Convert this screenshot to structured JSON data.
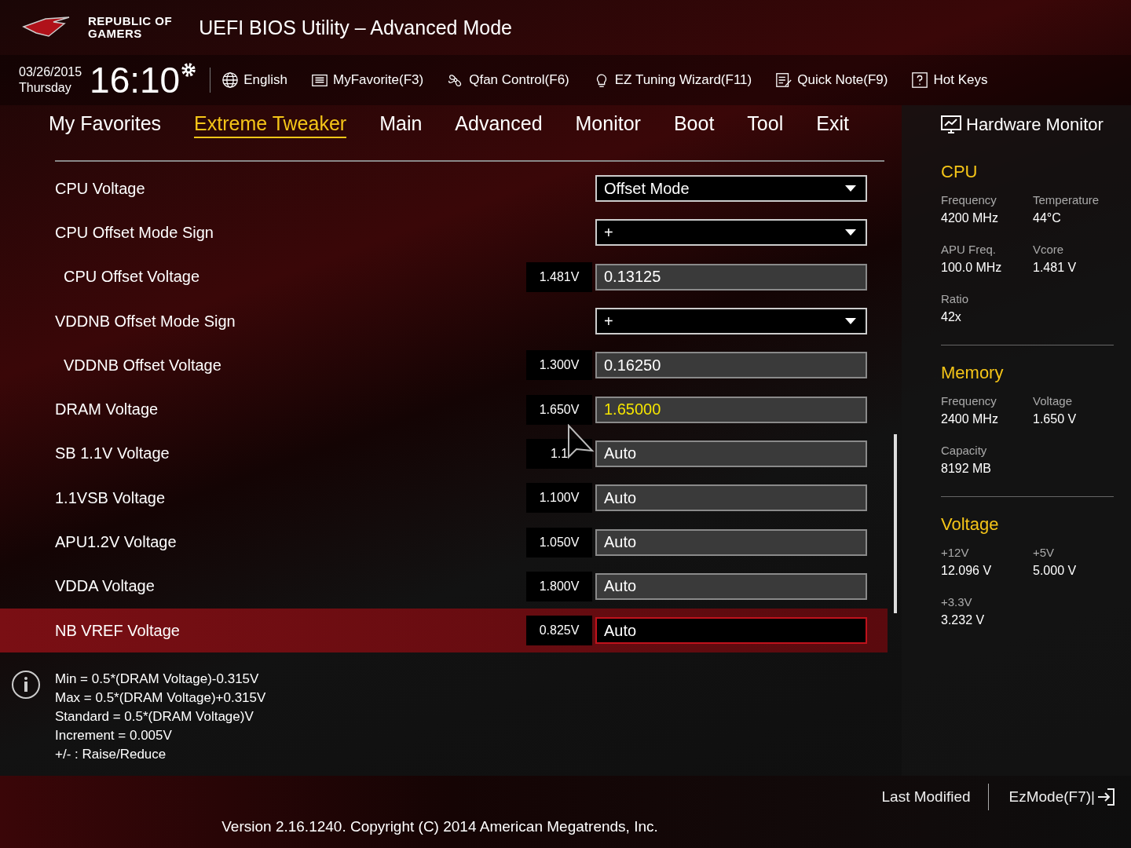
{
  "header": {
    "brand_line_1": "REPUBLIC OF",
    "brand_line_2": "GAMERS",
    "title": "UEFI BIOS Utility – Advanced Mode",
    "date": "03/26/2015",
    "day": "Thursday",
    "time": "16:10",
    "tools": [
      {
        "kind": "globe",
        "label": "English"
      },
      {
        "kind": "favorite",
        "label": "MyFavorite(F3)"
      },
      {
        "kind": "fan",
        "label": "Qfan Control(F6)"
      },
      {
        "kind": "bulb",
        "label": "EZ Tuning Wizard(F11)"
      },
      {
        "kind": "note",
        "label": "Quick Note(F9)"
      },
      {
        "kind": "help",
        "label": "Hot Keys"
      }
    ]
  },
  "tabs": [
    {
      "label": "My Favorites",
      "selected": false
    },
    {
      "label": "Extreme Tweaker",
      "selected": true
    },
    {
      "label": "Main",
      "selected": false
    },
    {
      "label": "Advanced",
      "selected": false
    },
    {
      "label": "Monitor",
      "selected": false
    },
    {
      "label": "Boot",
      "selected": false
    },
    {
      "label": "Tool",
      "selected": false
    },
    {
      "label": "Exit",
      "selected": false
    }
  ],
  "settings": [
    {
      "label": "CPU Voltage",
      "indented": false,
      "kind": "dropdown",
      "value": "Offset Mode",
      "selected": false
    },
    {
      "label": "CPU Offset Mode Sign",
      "indented": false,
      "kind": "dropdown",
      "value": "+",
      "selected": false
    },
    {
      "label": "CPU Offset Voltage",
      "indented": true,
      "kind": "input",
      "reading": "1.481V",
      "value": "0.13125",
      "selected": false,
      "modified": false
    },
    {
      "label": "VDDNB Offset Mode Sign",
      "indented": false,
      "kind": "dropdown",
      "value": "+",
      "selected": false
    },
    {
      "label": "VDDNB Offset Voltage",
      "indented": true,
      "kind": "input",
      "reading": "1.300V",
      "value": "0.16250",
      "selected": false,
      "modified": false
    },
    {
      "label": "DRAM Voltage",
      "indented": false,
      "kind": "input",
      "reading": "1.650V",
      "value": "1.65000",
      "selected": false,
      "modified": true
    },
    {
      "label": "SB 1.1V Voltage",
      "indented": false,
      "kind": "input",
      "reading": "1.1",
      "value": "Auto",
      "selected": false,
      "modified": false
    },
    {
      "label": "1.1VSB Voltage",
      "indented": false,
      "kind": "input",
      "reading": "1.100V",
      "value": "Auto",
      "selected": false,
      "modified": false
    },
    {
      "label": "APU1.2V Voltage",
      "indented": false,
      "kind": "input",
      "reading": "1.050V",
      "value": "Auto",
      "selected": false,
      "modified": false
    },
    {
      "label": "VDDA Voltage",
      "indented": false,
      "kind": "input",
      "reading": "1.800V",
      "value": "Auto",
      "selected": false,
      "modified": false
    },
    {
      "label": "NB VREF Voltage",
      "indented": false,
      "kind": "input",
      "reading": "0.825V",
      "value": "Auto",
      "selected": true,
      "modified": false
    }
  ],
  "help": [
    "Min = 0.5*(DRAM Voltage)-0.315V",
    "Max = 0.5*(DRAM Voltage)+0.315V",
    "Standard = 0.5*(DRAM Voltage)V",
    "Increment = 0.005V",
    "+/- : Raise/Reduce"
  ],
  "hardware_monitor": {
    "title": "Hardware Monitor",
    "sections": [
      {
        "title": "CPU",
        "items": [
          {
            "label": "Frequency",
            "value": "4200 MHz"
          },
          {
            "label": "Temperature",
            "value": "44°C"
          },
          {
            "label": "APU Freq.",
            "value": "100.0 MHz"
          },
          {
            "label": "Vcore",
            "value": "1.481 V"
          },
          {
            "label": "Ratio",
            "value": "42x"
          }
        ]
      },
      {
        "title": "Memory",
        "items": [
          {
            "label": "Frequency",
            "value": "2400 MHz"
          },
          {
            "label": "Voltage",
            "value": "1.650 V"
          },
          {
            "label": "Capacity",
            "value": "8192 MB"
          }
        ]
      },
      {
        "title": "Voltage",
        "items": [
          {
            "label": "+12V",
            "value": "12.096 V"
          },
          {
            "label": "+5V",
            "value": "5.000 V"
          },
          {
            "label": "+3.3V",
            "value": "3.232 V"
          }
        ]
      }
    ]
  },
  "footer": {
    "last_modified": "Last Modified",
    "ez_mode": "EzMode(F7)|",
    "version": "Version 2.16.1240. Copyright (C) 2014 American Megatrends, Inc."
  }
}
